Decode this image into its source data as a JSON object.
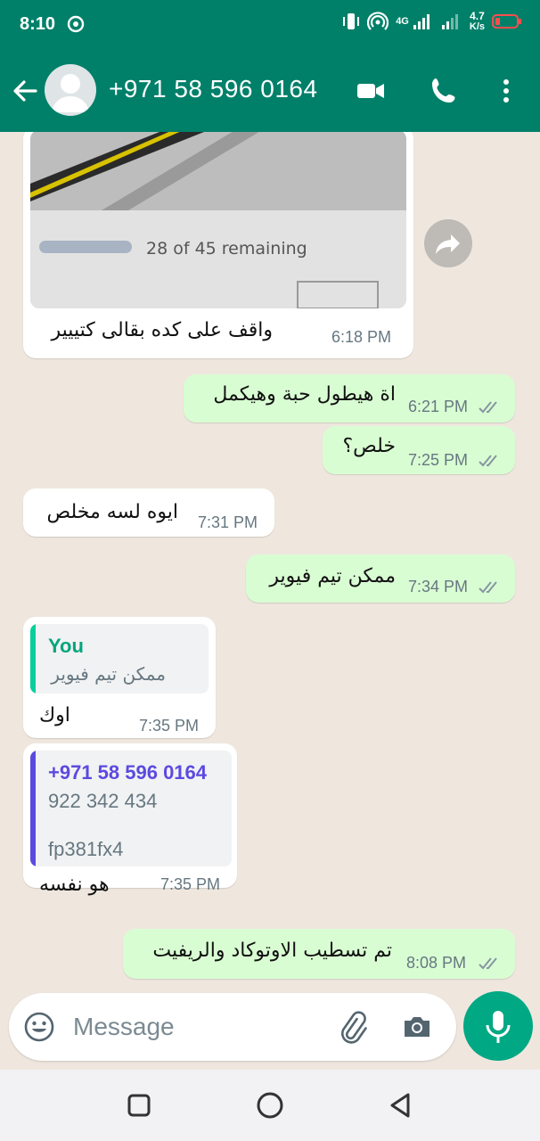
{
  "status_bar": {
    "time": "8:10",
    "network": "4G",
    "speed_value": "4.7",
    "speed_unit": "K/s"
  },
  "header": {
    "contact_name": "+971 58 596 0164",
    "icons": [
      "back-arrow-icon",
      "avatar-icon",
      "video-call-icon",
      "voice-call-icon",
      "more-vert-icon"
    ]
  },
  "messages": [
    {
      "dir": "in",
      "type": "image",
      "image_text": "28 of 45 remaining",
      "text": "واقف على كده بقالى كتييير",
      "time": "6:18 PM"
    },
    {
      "dir": "out",
      "text": "اة هيطول حبة وهيكمل",
      "time": "6:21 PM",
      "status": "read"
    },
    {
      "dir": "out",
      "text": "خلص؟",
      "time": "7:25 PM",
      "status": "read"
    },
    {
      "dir": "in",
      "text": "ايوه لسه مخلص",
      "time": "7:31 PM"
    },
    {
      "dir": "out",
      "text": "ممكن تيم فيوير",
      "time": "7:34 PM",
      "status": "read"
    },
    {
      "dir": "in",
      "quote": {
        "author": "You",
        "text": "ممكن تيم فيوير"
      },
      "text": "اوك",
      "time": "7:35 PM"
    },
    {
      "dir": "in",
      "quote": {
        "author": "+971 58 596 0164",
        "line1": "922 342 434",
        "line2": "fp381fx4"
      },
      "text": "هو نفسه",
      "time": "7:35 PM"
    },
    {
      "dir": "out",
      "text": "تم تسطيب الاوتوكاد والريفيت",
      "time": "8:08 PM",
      "status": "read"
    }
  ],
  "composer": {
    "placeholder": "Message"
  },
  "colors": {
    "header": "#008069",
    "chat_bg": "#efe7de",
    "outgoing_bubble": "#d9fdd3",
    "incoming_bubble": "#ffffff",
    "read_ticks": "#8696a0",
    "quote_you": "#06cf9c",
    "quote_contact": "#5b4ae0",
    "mic_button": "#00a884"
  }
}
